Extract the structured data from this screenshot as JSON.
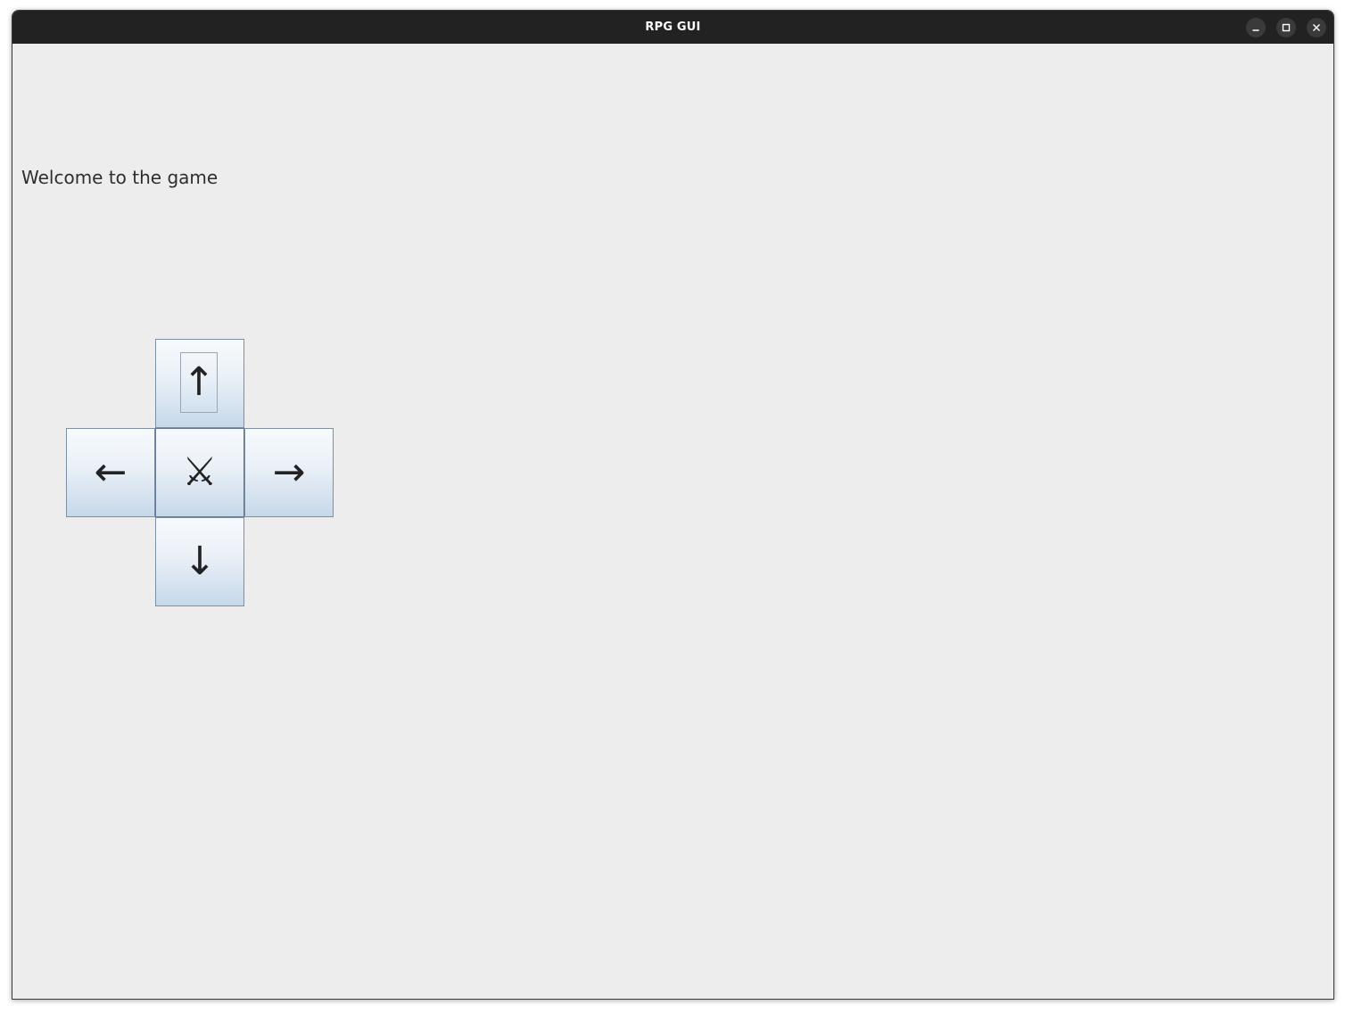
{
  "window": {
    "title": "RPG GUI",
    "controls": {
      "minimize": "minimize-icon",
      "maximize": "maximize-icon",
      "close": "close-icon"
    }
  },
  "main": {
    "welcome_text": "Welcome to the game"
  },
  "dpad": {
    "up": "↑",
    "left": "←",
    "attack": "⚔",
    "right": "→",
    "down": "↓",
    "focused": "up"
  },
  "colors": {
    "titlebar": "#222222",
    "background": "#ededed",
    "button_top": "#f7fafd",
    "button_bottom": "#c6d8ea",
    "button_border": "#7d8fa3"
  }
}
